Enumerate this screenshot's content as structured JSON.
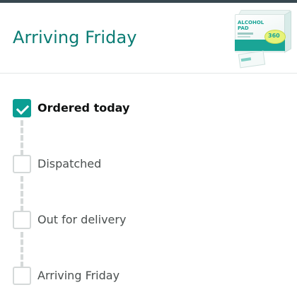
{
  "header": {
    "title": "Arriving Friday",
    "product_image": {
      "icon": "alcohol-pad-box-image",
      "text": "ALCOHOL PAD",
      "badge": "360"
    }
  },
  "tracker": {
    "steps": [
      {
        "label": "Ordered today",
        "completed": true
      },
      {
        "label": "Dispatched",
        "completed": false
      },
      {
        "label": "Out for delivery",
        "completed": false
      },
      {
        "label": "Arriving Friday",
        "completed": false
      }
    ]
  },
  "colors": {
    "accent": "#0b9e93",
    "title": "#0b7c74",
    "inactive": "#d5d9d9",
    "top_bar": "#37474f"
  }
}
